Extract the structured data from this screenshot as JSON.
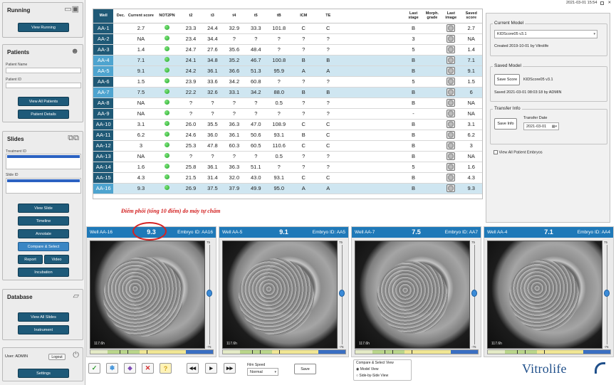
{
  "app": {
    "datetime": "2021-03-01 15:54"
  },
  "sidebar": {
    "running": {
      "title": "Running",
      "view_btn": "View Running"
    },
    "patients": {
      "title": "Patients",
      "name_label": "Patient Name",
      "id_label": "Patient ID",
      "view_all_btn": "View All Patients",
      "details_btn": "Patient Details"
    },
    "slides": {
      "title": "Slides",
      "treatment_label": "Treatment ID",
      "slide_label": "Slide ID",
      "buttons": {
        "view_slide": "View Slide",
        "timeline": "Timeline",
        "annotate": "Annotate",
        "compare": "Compare & Select",
        "report": "Report",
        "video": "Video",
        "incubation": "Incubation"
      }
    },
    "database": {
      "title": "Database",
      "view_slides_btn": "View All Slides",
      "instrument_btn": "Instrument"
    },
    "user": {
      "label": "User: ADMIN",
      "logout": "Logout",
      "settings": "Settings"
    }
  },
  "table": {
    "columns": [
      "Well",
      "Dec.",
      "Current score",
      "NOT2PN",
      "t2",
      "t3",
      "t4",
      "t5",
      "tB",
      "ICM",
      "TE",
      "",
      "Last stage",
      "Morph. grade",
      "Last image",
      "Saved score"
    ],
    "rows": [
      {
        "well": "AA-1",
        "dec": "",
        "score": "2.7",
        "t2": "23.3",
        "t3": "24.4",
        "t4": "32.9",
        "t5": "33.3",
        "tB": "101.8",
        "icm": "C",
        "te": "C",
        "stage": "B",
        "morph": "",
        "saved": "2.7",
        "hl": false
      },
      {
        "well": "AA-2",
        "dec": "",
        "score": "NA",
        "t2": "23.4",
        "t3": "34.4",
        "t4": "?",
        "t5": "?",
        "tB": "?",
        "icm": "?",
        "te": "?",
        "stage": "3",
        "morph": "",
        "saved": "NA",
        "hl": false
      },
      {
        "well": "AA-3",
        "dec": "",
        "score": "1.4",
        "t2": "24.7",
        "t3": "27.6",
        "t4": "35.6",
        "t5": "48.4",
        "tB": "?",
        "icm": "?",
        "te": "?",
        "stage": "5",
        "morph": "",
        "saved": "1.4",
        "hl": false
      },
      {
        "well": "AA-4",
        "dec": "",
        "score": "7.1",
        "t2": "24.1",
        "t3": "34.8",
        "t4": "35.2",
        "t5": "46.7",
        "tB": "100.8",
        "icm": "B",
        "te": "B",
        "stage": "B",
        "morph": "",
        "saved": "7.1",
        "hl": true
      },
      {
        "well": "AA-5",
        "dec": "",
        "score": "9.1",
        "t2": "24.2",
        "t3": "36.1",
        "t4": "36.6",
        "t5": "51.3",
        "tB": "95.9",
        "icm": "A",
        "te": "A",
        "stage": "B",
        "morph": "",
        "saved": "9.1",
        "hl": true
      },
      {
        "well": "AA-6",
        "dec": "",
        "score": "1.5",
        "t2": "23.9",
        "t3": "33.6",
        "t4": "34.2",
        "t5": "60.8",
        "tB": "?",
        "icm": "?",
        "te": "?",
        "stage": "5",
        "morph": "",
        "saved": "1.5",
        "hl": false
      },
      {
        "well": "AA-7",
        "dec": "",
        "score": "7.5",
        "t2": "22.2",
        "t3": "32.6",
        "t4": "33.1",
        "t5": "34.2",
        "tB": "88.0",
        "icm": "B",
        "te": "B",
        "stage": "B",
        "morph": "",
        "saved": "6",
        "hl": true
      },
      {
        "well": "AA-8",
        "dec": "",
        "score": "NA",
        "t2": "?",
        "t3": "?",
        "t4": "?",
        "t5": "?",
        "tB": "0.5",
        "icm": "?",
        "te": "?",
        "stage": "B",
        "morph": "",
        "saved": "NA",
        "hl": false
      },
      {
        "well": "AA-9",
        "dec": "",
        "score": "NA",
        "t2": "?",
        "t3": "?",
        "t4": "?",
        "t5": "?",
        "tB": "?",
        "icm": "?",
        "te": "?",
        "stage": "-",
        "morph": "",
        "saved": "NA",
        "hl": false
      },
      {
        "well": "AA-10",
        "dec": "",
        "score": "3.1",
        "t2": "26.0",
        "t3": "35.5",
        "t4": "36.3",
        "t5": "47.0",
        "tB": "108.9",
        "icm": "C",
        "te": "C",
        "stage": "B",
        "morph": "",
        "saved": "3.1",
        "hl": false
      },
      {
        "well": "AA-11",
        "dec": "",
        "score": "6.2",
        "t2": "24.6",
        "t3": "36.0",
        "t4": "36.1",
        "t5": "50.6",
        "tB": "93.1",
        "icm": "B",
        "te": "C",
        "stage": "B",
        "morph": "",
        "saved": "6.2",
        "hl": false
      },
      {
        "well": "AA-12",
        "dec": "",
        "score": "3",
        "t2": "25.3",
        "t3": "47.8",
        "t4": "60.3",
        "t5": "60.5",
        "tB": "110.6",
        "icm": "C",
        "te": "C",
        "stage": "B",
        "morph": "",
        "saved": "3",
        "hl": false
      },
      {
        "well": "AA-13",
        "dec": "",
        "score": "NA",
        "t2": "?",
        "t3": "?",
        "t4": "?",
        "t5": "?",
        "tB": "0.5",
        "icm": "?",
        "te": "?",
        "stage": "B",
        "morph": "",
        "saved": "NA",
        "hl": false
      },
      {
        "well": "AA-14",
        "dec": "",
        "score": "1.6",
        "t2": "25.8",
        "t3": "36.1",
        "t4": "36.3",
        "t5": "51.1",
        "tB": "?",
        "icm": "?",
        "te": "?",
        "stage": "5",
        "morph": "",
        "saved": "1.6",
        "hl": false
      },
      {
        "well": "AA-15",
        "dec": "",
        "score": "4.3",
        "t2": "21.5",
        "t3": "31.4",
        "t4": "32.0",
        "t5": "43.0",
        "tB": "93.1",
        "icm": "C",
        "te": "C",
        "stage": "B",
        "morph": "",
        "saved": "4.3",
        "hl": false
      },
      {
        "well": "AA-16",
        "dec": "",
        "score": "9.3",
        "t2": "26.9",
        "t3": "37.5",
        "t4": "37.9",
        "t5": "49.9",
        "tB": "95.0",
        "icm": "A",
        "te": "A",
        "stage": "B",
        "morph": "",
        "saved": "9.3",
        "hl": true
      }
    ]
  },
  "right_panel": {
    "current_model": {
      "title": "Current Model",
      "selected": "KIDScore05 v3.1",
      "created": "Created 2019-10-01 by Vitrolife"
    },
    "saved_model": {
      "title": "Saved Model",
      "save_btn": "Save Score",
      "model": "KIDScore05 v3.1",
      "saved": "Saved 2021-03-01 08:03:18 by ADMIN"
    },
    "transfer": {
      "title": "Transfer Info",
      "save_btn": "Save Info",
      "date_label": "Transfer Date",
      "date": "2021-03-01"
    },
    "view_all": "View All Patient Embryos"
  },
  "annotation": "Điểm phôi (tổng 10 điểm) do máy tự chấm",
  "embryos": [
    {
      "well": "Well AA-16",
      "score": "9.3",
      "embryo_id": "Embryo ID: AA16",
      "time": "117.6h",
      "slider_top": "75",
      "slider_bottom": "-75"
    },
    {
      "well": "Well AA-5",
      "score": "9.1",
      "embryo_id": "Embryo ID: AA5",
      "time": "117.6h",
      "slider_top": "75",
      "slider_bottom": "-75"
    },
    {
      "well": "Well AA-7",
      "score": "7.5",
      "embryo_id": "Embryo ID: AA7",
      "time": "117.6h",
      "slider_top": "75",
      "slider_bottom": "-75"
    },
    {
      "well": "Well AA-4",
      "score": "7.1",
      "embryo_id": "Embryo ID: AA4",
      "time": "117.6h",
      "slider_top": "75",
      "slider_bottom": "-75"
    }
  ],
  "toolbar": {
    "film_speed_label": "Film Speed",
    "film_speed_value": "Normal",
    "save_label": "Save",
    "view_group_title": "Compare & Select View",
    "model_view": "Model View",
    "side_view": "Side-by-Side View"
  },
  "brand": "Vitrolife",
  "colors": {
    "accent": "#1f79b8",
    "well_dark": "#1f5976",
    "well_highlight": "#4ea4cf",
    "annotation_red": "#d22020",
    "dot_green": "#23a62b"
  }
}
